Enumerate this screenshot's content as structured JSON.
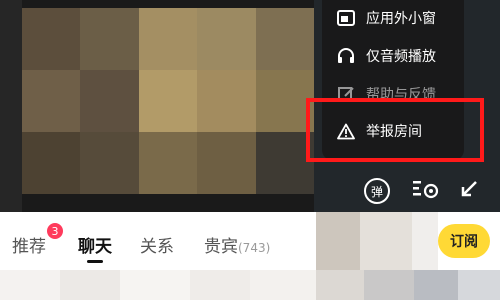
{
  "overlay_menu": {
    "items": [
      {
        "label": "应用外小窗",
        "icon": "picture-in-picture-icon"
      },
      {
        "label": "仅音频播放",
        "icon": "headphones-icon"
      },
      {
        "label": "帮助与反馈",
        "icon": "feedback-edit-icon"
      },
      {
        "label": "举报房间",
        "icon": "warning-triangle-icon"
      }
    ]
  },
  "video_controls": {
    "danmaku_label": "弹",
    "danmaku_icon": "danmaku-toggle-icon",
    "settings_icon": "danmaku-settings-icon",
    "exit_fullscreen_icon": "shrink-arrow-icon"
  },
  "tabs": {
    "items": [
      {
        "label": "推荐"
      },
      {
        "label": "聊天"
      },
      {
        "label": "关系"
      },
      {
        "label": "贵宾"
      }
    ],
    "badge": "3",
    "guest_count": "(743)"
  },
  "subscribe": {
    "label": "订阅"
  },
  "colors": {
    "highlight": "#ff1a1a",
    "accent": "#ffd935",
    "badge": "#ff3b5c"
  }
}
